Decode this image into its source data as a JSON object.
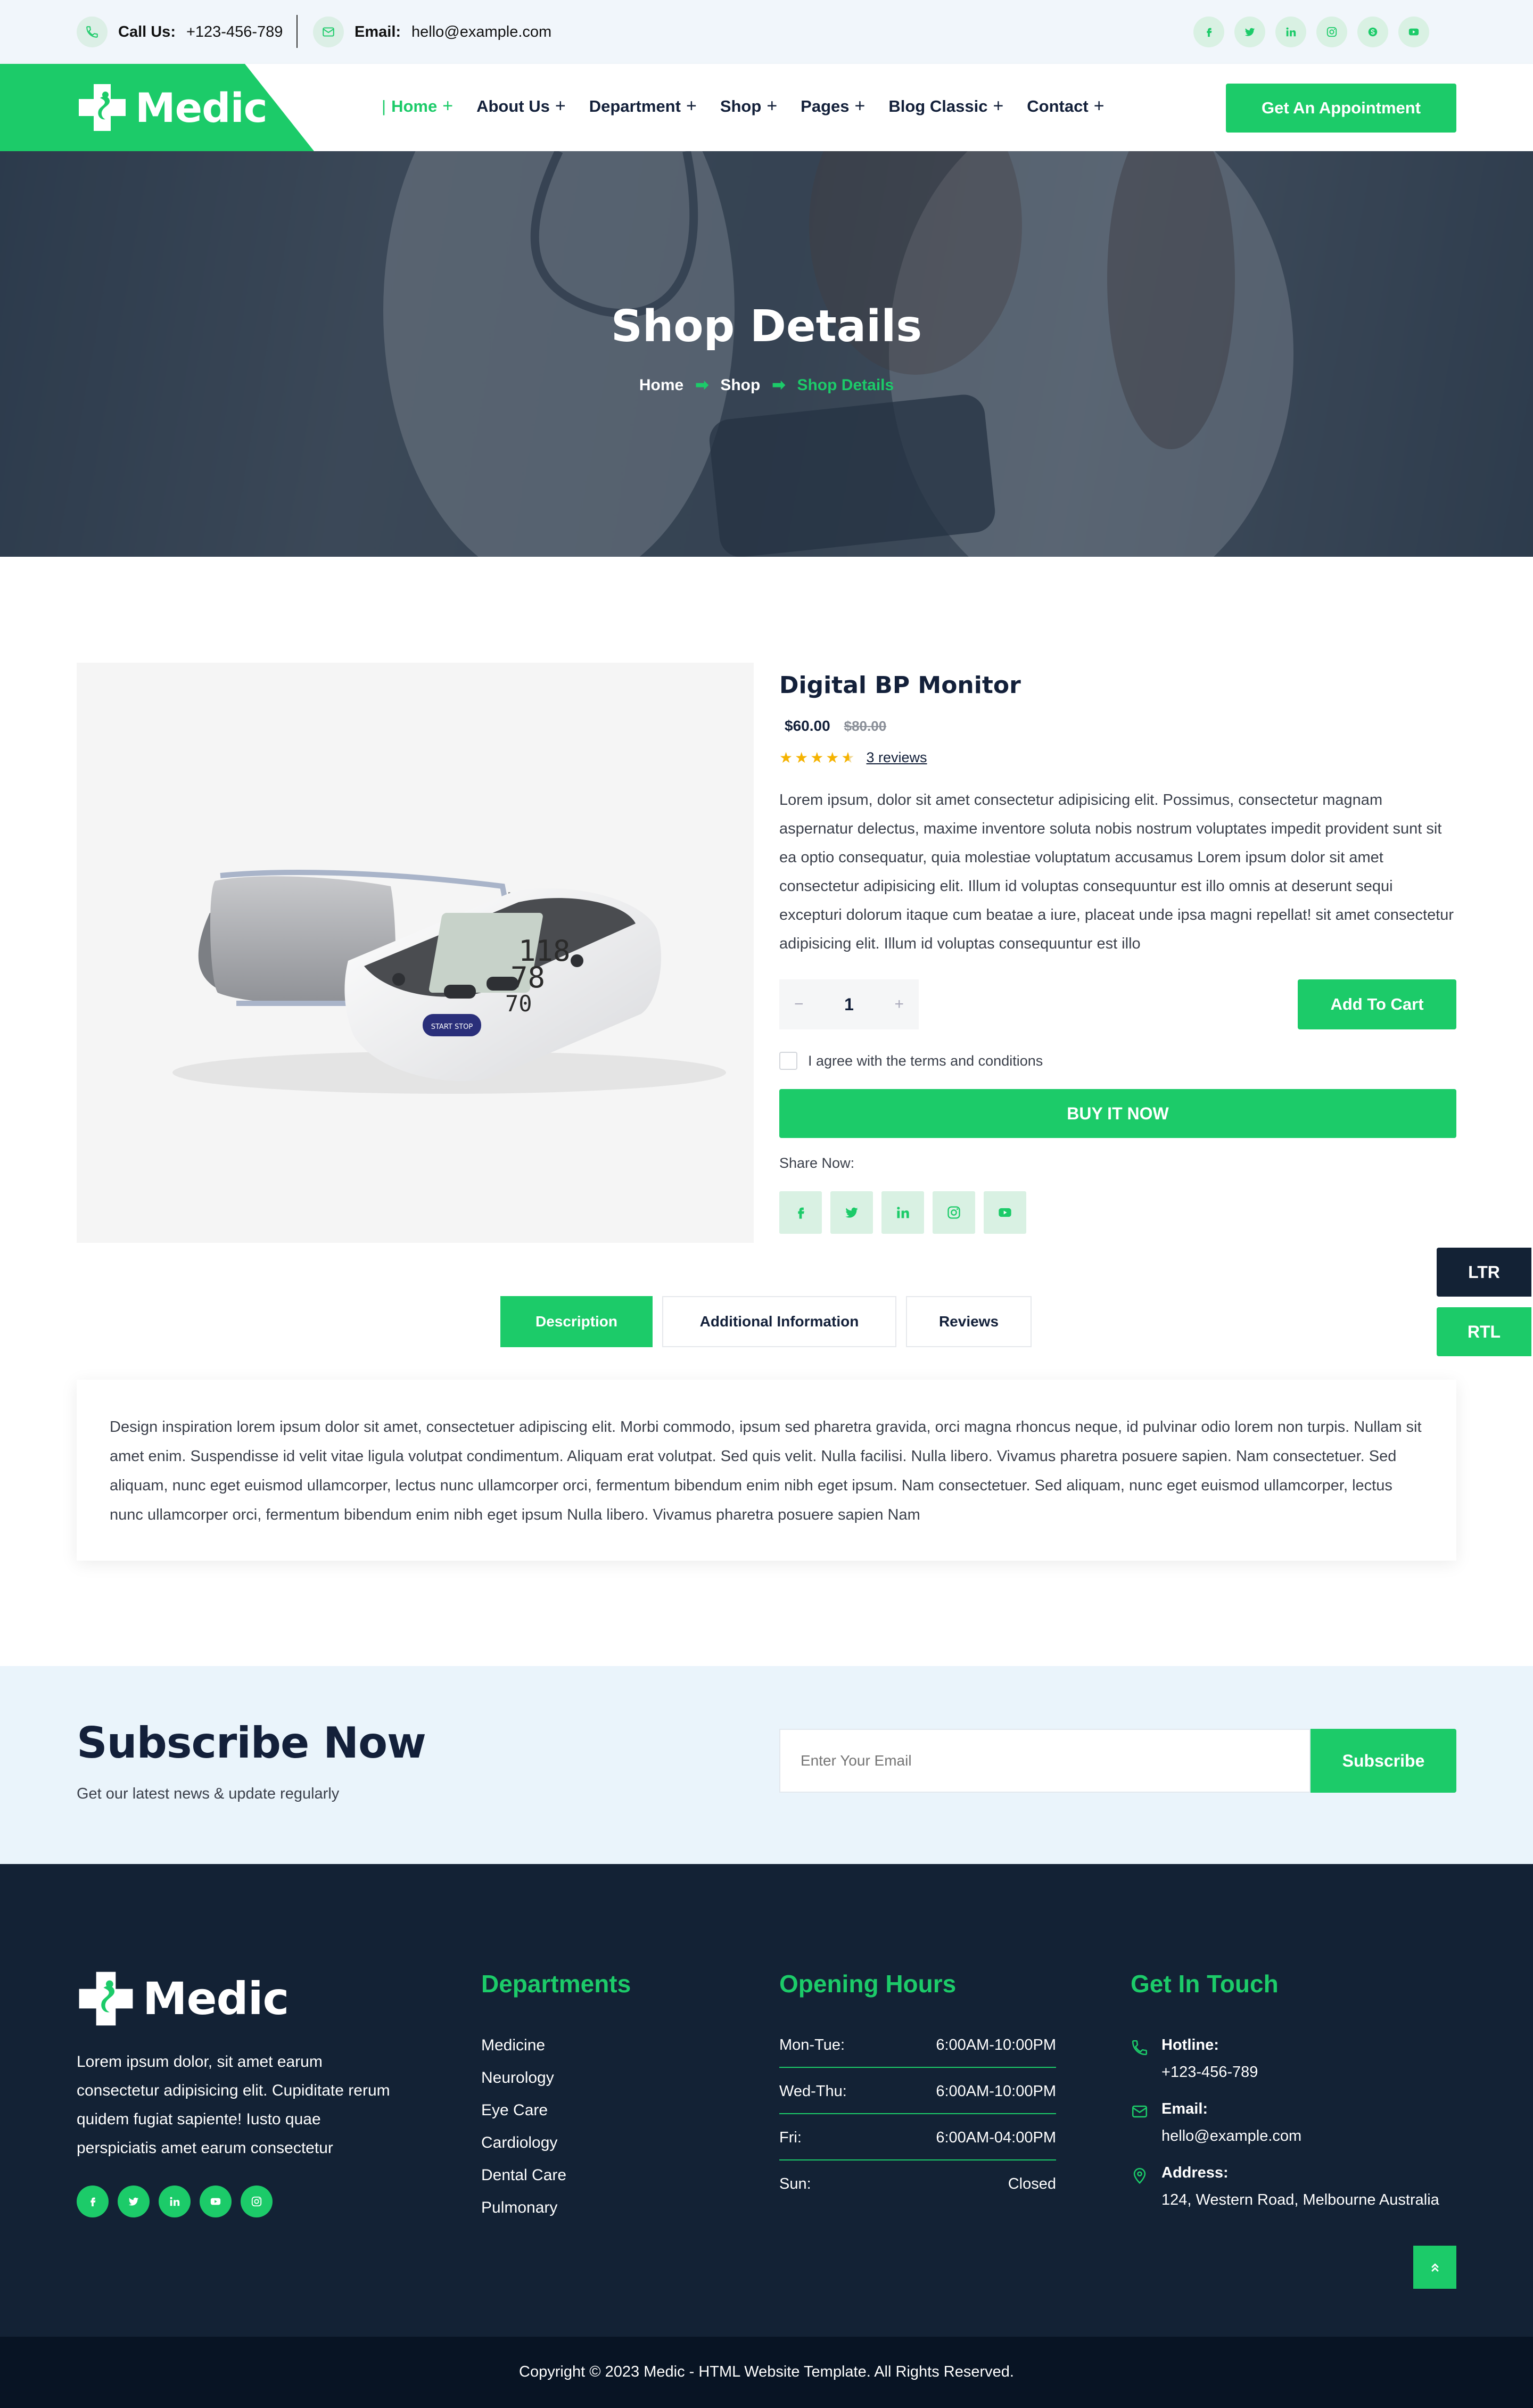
{
  "topbar": {
    "call_label": "Call Us:",
    "call_value": "+123-456-789",
    "email_label": "Email:",
    "email_value": "hello@example.com",
    "social": [
      "facebook-icon",
      "twitter-icon",
      "linkedin-icon",
      "instagram-icon",
      "skype-icon",
      "youtube-icon"
    ]
  },
  "brand": {
    "name": "Medic",
    "accent": "#1ccb69",
    "dark": "#132235"
  },
  "nav": {
    "items": [
      "Home",
      "About Us",
      "Department",
      "Shop",
      "Pages",
      "Blog Classic",
      "Contact"
    ],
    "cta": "Get An Appointment"
  },
  "hero": {
    "title": "Shop Details",
    "breadcrumb": [
      "Home",
      "Shop",
      "Shop Details"
    ]
  },
  "product": {
    "name": "Digital BP Monitor",
    "price": "$60.00",
    "old_price": "$80.00",
    "rating": 4.5,
    "reviews": "3 reviews",
    "description": "Lorem ipsum, dolor sit amet consectetur adipisicing elit. Possimus, consectetur magnam aspernatur delectus, maxime inventore soluta nobis nostrum voluptates impedit provident sunt sit ea optio consequatur, quia molestiae voluptatum accusamus Lorem ipsum dolor sit amet consectetur adipisicing elit. Illum id voluptas consequuntur est illo omnis at deserunt sequi excepturi dolorum itaque cum beatae a iure, placeat unde ipsa magni repellat! sit amet consectetur adipisicing elit. Illum id voluptas consequuntur est illo",
    "qty_minus": "−",
    "qty": "1",
    "qty_plus": "+",
    "add_to_cart": "Add To Cart",
    "terms": "I agree with the terms and conditions",
    "buy_now": "BUY IT NOW",
    "share_label": "Share Now:",
    "monitor_sys": "118",
    "monitor_dia": "78",
    "monitor_pulse": "70",
    "monitor_start": "START STOP"
  },
  "dir_buttons": {
    "ltr": "LTR",
    "rtl": "RTL"
  },
  "tabs": {
    "items": [
      "Description",
      "Additional Information",
      "Reviews"
    ],
    "active": "Description",
    "content": "Design inspiration lorem ipsum dolor sit amet, consectetuer adipiscing elit. Morbi commodo, ipsum sed pharetra gravida, orci magna rhoncus neque, id pulvinar odio lorem non turpis. Nullam sit amet enim. Suspendisse id velit vitae ligula volutpat condimentum. Aliquam erat volutpat. Sed quis velit. Nulla facilisi. Nulla libero. Vivamus pharetra posuere sapien. Nam consectetuer. Sed aliquam, nunc eget euismod ullamcorper, lectus nunc ullamcorper orci, fermentum bibendum enim nibh eget ipsum. Nam consectetuer. Sed aliquam, nunc eget euismod ullamcorper, lectus nunc ullamcorper orci, fermentum bibendum enim nibh eget ipsum Nulla libero. Vivamus pharetra posuere sapien Nam"
  },
  "subscribe": {
    "title": "Subscribe Now",
    "subtitle": "Get our latest news & update regularly",
    "placeholder": "Enter Your Email",
    "button": "Subscribe"
  },
  "footer": {
    "about": "Lorem ipsum dolor, sit amet earum consectetur adipisicing elit. Cupiditate rerum quidem fugiat sapiente! Iusto quae perspiciatis amet earum consectetur",
    "departments_title": "Departments",
    "departments": [
      "Medicine",
      "Neurology",
      "Eye Care",
      "Cardiology",
      "Dental Care",
      "Pulmonary"
    ],
    "hours_title": "Opening Hours",
    "hours": [
      {
        "day": "Mon-Tue:",
        "time": "6:00AM-10:00PM"
      },
      {
        "day": "Wed-Thu:",
        "time": "6:00AM-10:00PM"
      },
      {
        "day": "Fri:",
        "time": "6:00AM-04:00PM"
      },
      {
        "day": "Sun:",
        "time": "Closed"
      }
    ],
    "contact_title": "Get In Touch",
    "hotline_label": "Hotline:",
    "hotline": "+123-456-789",
    "email_label": "Email:",
    "email": "hello@example.com",
    "address_label": "Address:",
    "address": "124, Western Road, Melbourne Australia",
    "copyright": "Copyright © 2023 Medic - HTML Website Template. All Rights Reserved."
  }
}
